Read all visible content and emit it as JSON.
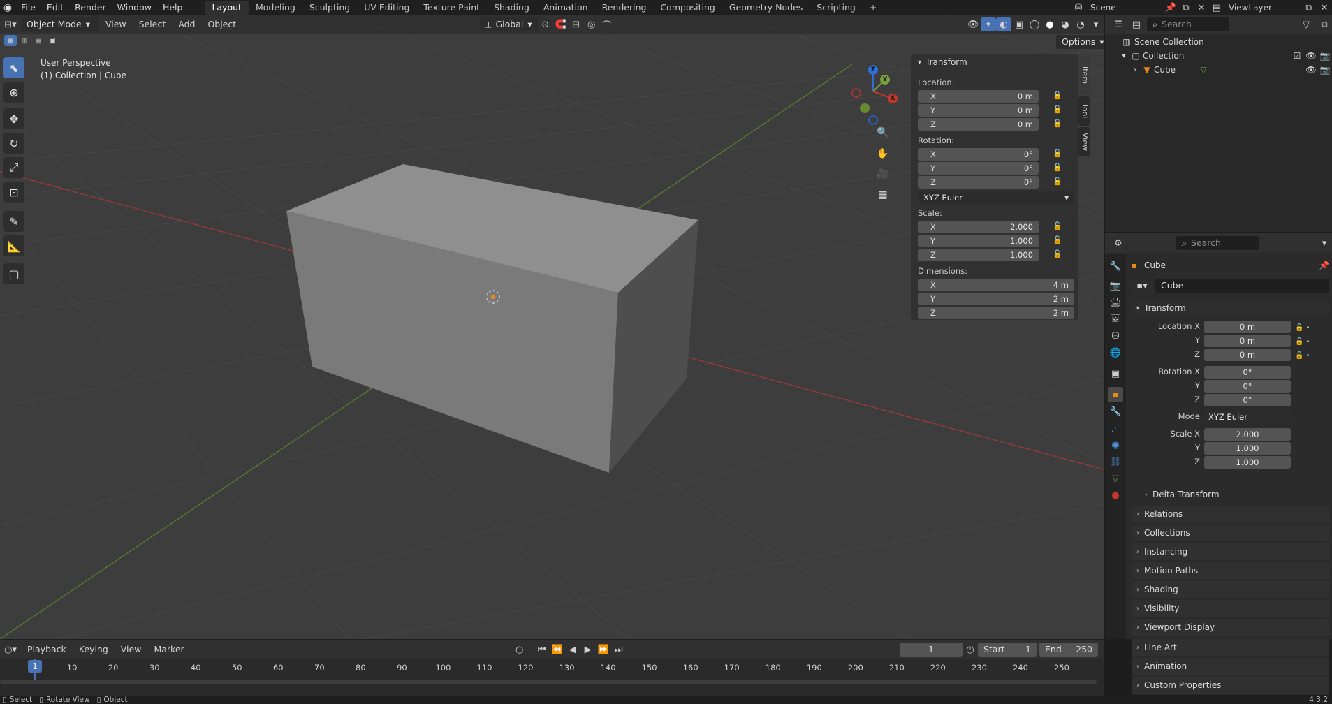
{
  "menu": {
    "file": "File",
    "edit": "Edit",
    "render": "Render",
    "window": "Window",
    "help": "Help"
  },
  "workspaces": [
    "Layout",
    "Modeling",
    "Sculpting",
    "UV Editing",
    "Texture Paint",
    "Shading",
    "Animation",
    "Rendering",
    "Compositing",
    "Geometry Nodes",
    "Scripting"
  ],
  "scene": {
    "name": "Scene",
    "view_layer": "ViewLayer"
  },
  "viewport": {
    "mode": "Object Mode",
    "menus": [
      "View",
      "Select",
      "Add",
      "Object"
    ],
    "orientation": "Global",
    "options": "Options",
    "overlay_title": "User Perspective",
    "overlay_subtitle": "(1) Collection | Cube",
    "gizmo": {
      "x": "X",
      "y": "Y",
      "z": "Z"
    }
  },
  "npanel": {
    "header": "Transform",
    "location_label": "Location:",
    "location": {
      "x": "0 m",
      "y": "0 m",
      "z": "0 m"
    },
    "rotation_label": "Rotation:",
    "rotation": {
      "x": "0°",
      "y": "0°",
      "z": "0°"
    },
    "rotation_mode": "XYZ Euler",
    "scale_label": "Scale:",
    "scale": {
      "x": "2.000",
      "y": "1.000",
      "z": "1.000"
    },
    "dimensions_label": "Dimensions:",
    "dimensions": {
      "x": "4 m",
      "y": "2 m",
      "z": "2 m"
    },
    "axes": {
      "x": "X",
      "y": "Y",
      "z": "Z"
    },
    "tabs": {
      "item": "Item",
      "tool": "Tool",
      "view": "View"
    }
  },
  "outliner": {
    "search_placeholder": "Search",
    "scene_collection": "Scene Collection",
    "collection": "Collection",
    "cube": "Cube"
  },
  "properties": {
    "search_placeholder": "Search",
    "object_name": "Cube",
    "datablock": "Cube",
    "transform": "Transform",
    "location_x_label": "Location X",
    "y_label": "Y",
    "z_label": "Z",
    "location": {
      "x": "0 m",
      "y": "0 m",
      "z": "0 m"
    },
    "rotation_x_label": "Rotation X",
    "rotation": {
      "x": "0°",
      "y": "0°",
      "z": "0°"
    },
    "mode_label": "Mode",
    "mode": "XYZ Euler",
    "scale_x_label": "Scale X",
    "scale": {
      "x": "2.000",
      "y": "1.000",
      "z": "1.000"
    },
    "delta_transform": "Delta Transform",
    "sections": [
      "Relations",
      "Collections",
      "Instancing",
      "Motion Paths",
      "Shading",
      "Visibility",
      "Viewport Display",
      "Line Art",
      "Animation",
      "Custom Properties"
    ]
  },
  "timeline": {
    "menus": [
      "Playback",
      "Keying",
      "View",
      "Marker"
    ],
    "current_frame": "1",
    "start_label": "Start",
    "start": "1",
    "end_label": "End",
    "end": "250",
    "ticks": [
      "1",
      "10",
      "20",
      "30",
      "40",
      "50",
      "60",
      "70",
      "80",
      "90",
      "100",
      "110",
      "120",
      "130",
      "140",
      "150",
      "160",
      "170",
      "180",
      "190",
      "200",
      "210",
      "220",
      "230",
      "240",
      "250"
    ]
  },
  "status": {
    "select": "Select",
    "rotate_view": "Rotate View",
    "object": "Object",
    "version": "4.3.2"
  },
  "colors": {
    "accent": "#4772b3",
    "x_axis": "#c0392b",
    "y_axis": "#7aa03a",
    "z_axis": "#2f6fd6",
    "origin": "#e88a1a"
  }
}
